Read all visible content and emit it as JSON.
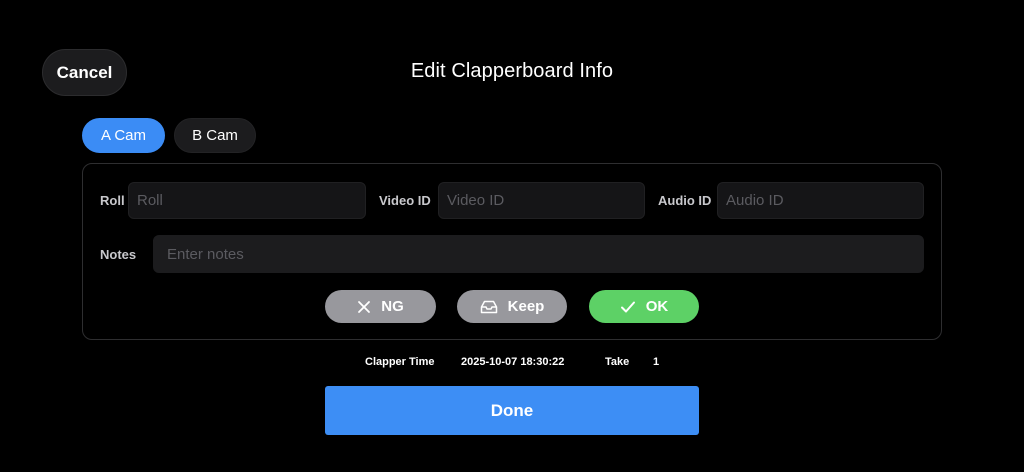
{
  "header": {
    "cancel_label": "Cancel",
    "title": "Edit Clapperboard Info"
  },
  "cam_tabs": [
    {
      "label": "A Cam",
      "selected": true
    },
    {
      "label": "B Cam",
      "selected": false
    }
  ],
  "fields": {
    "roll": {
      "label": "Roll",
      "value": "",
      "placeholder": "Roll"
    },
    "video_id": {
      "label": "Video ID",
      "value": "",
      "placeholder": "Video ID"
    },
    "audio_id": {
      "label": "Audio ID",
      "value": "",
      "placeholder": "Audio ID"
    },
    "notes": {
      "label": "Notes",
      "value": "",
      "placeholder": "Enter notes"
    }
  },
  "actions": {
    "ng": {
      "label": "NG",
      "icon": "x-icon"
    },
    "keep": {
      "label": "Keep",
      "icon": "tray-icon"
    },
    "ok": {
      "label": "OK",
      "icon": "checkmark-icon"
    }
  },
  "meta": {
    "clapper_time_label": "Clapper Time",
    "clapper_time_value": "2025-10-07 18:30:22",
    "take_label": "Take",
    "take_value": "1"
  },
  "footer": {
    "done_label": "Done"
  },
  "colors": {
    "accent_blue": "#3d8ef5",
    "ok_green": "#5dd166",
    "neutral_gray": "#98989d",
    "background": "#000000"
  }
}
